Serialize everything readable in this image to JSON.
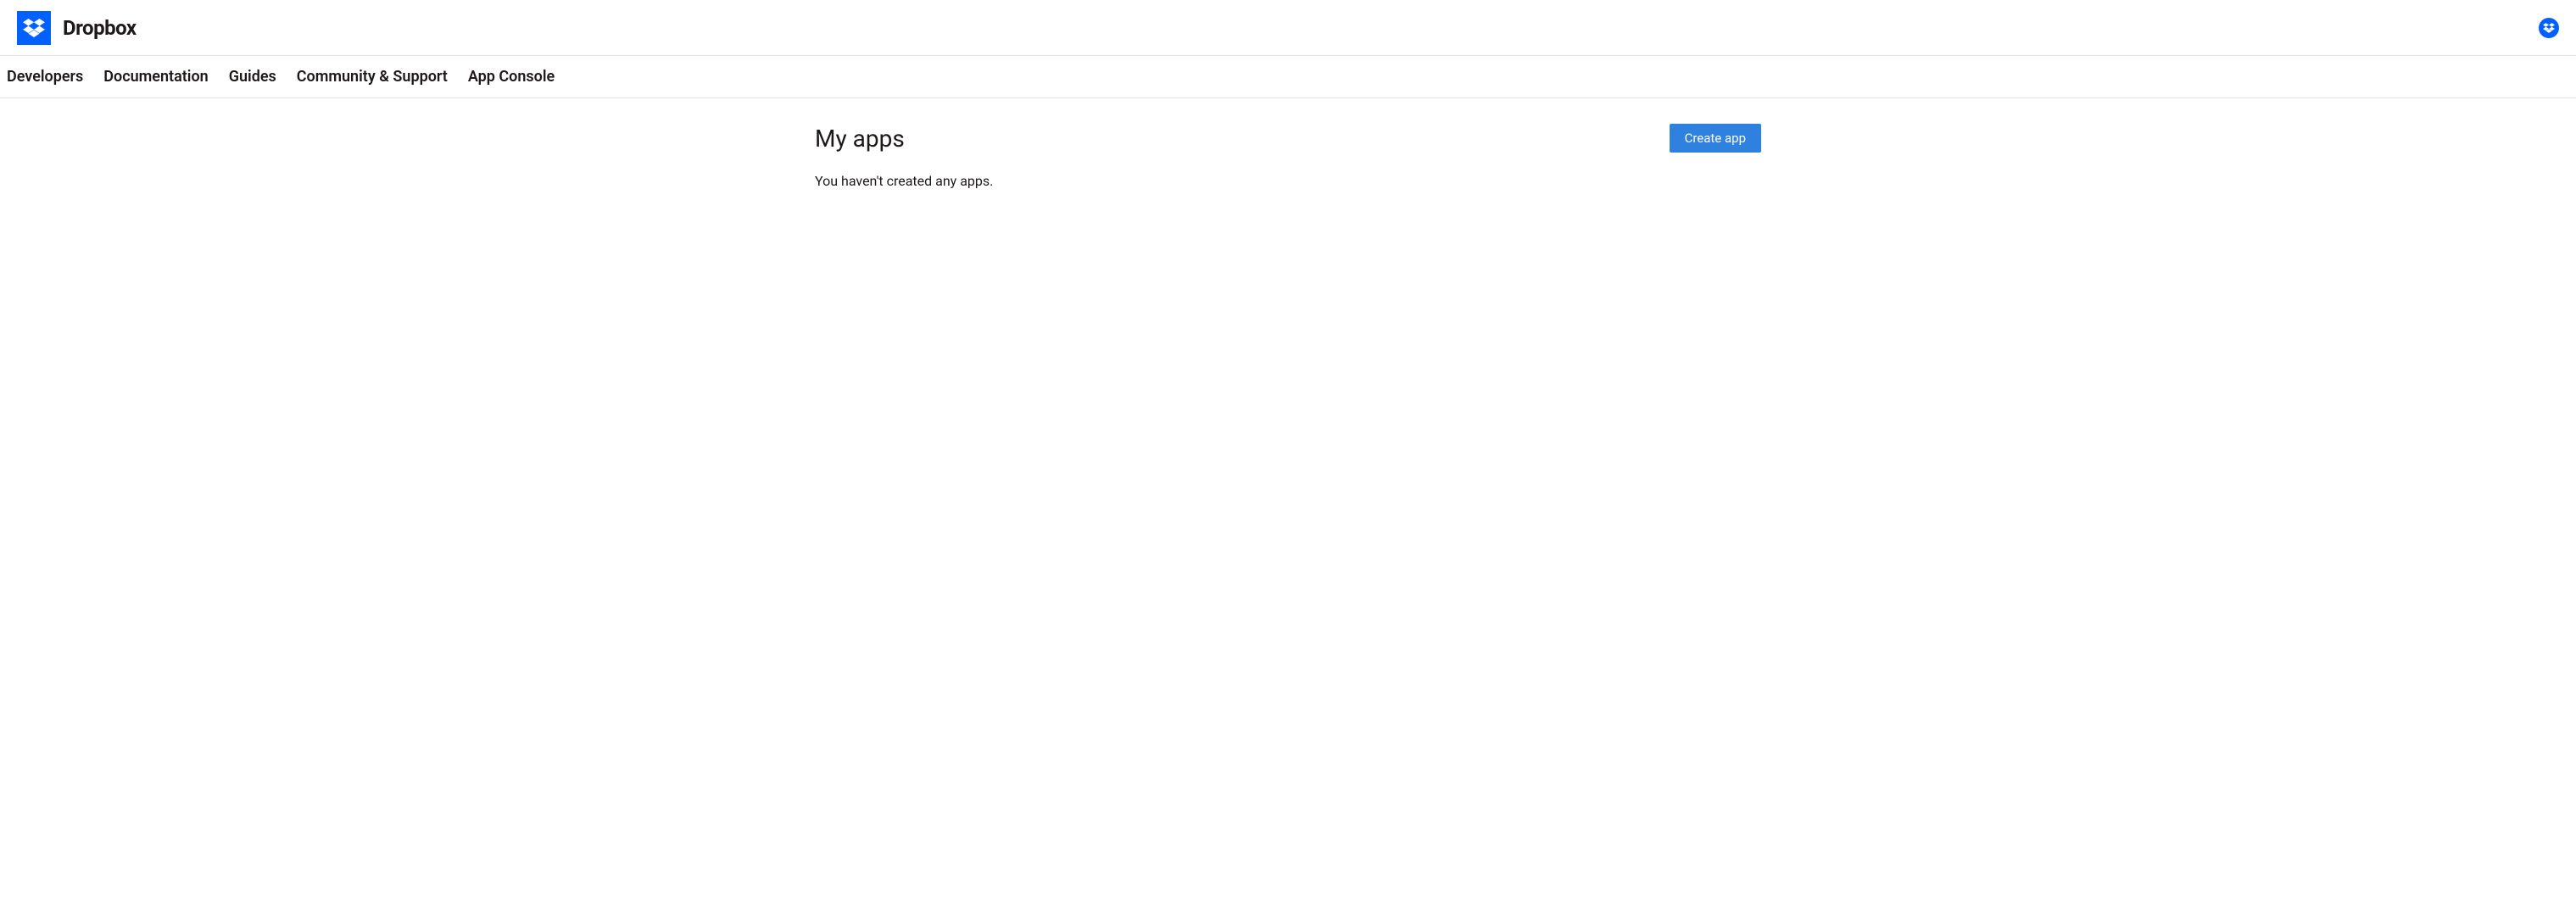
{
  "brand": {
    "name": "Dropbox"
  },
  "nav": [
    {
      "label": "Developers"
    },
    {
      "label": "Documentation"
    },
    {
      "label": "Guides"
    },
    {
      "label": "Community & Support"
    },
    {
      "label": "App Console"
    }
  ],
  "main": {
    "title": "My apps",
    "empty_message": "You haven't created any apps.",
    "create_button_label": "Create app"
  },
  "colors": {
    "brand_blue": "#0061fe",
    "button_blue": "#2f81e0"
  }
}
